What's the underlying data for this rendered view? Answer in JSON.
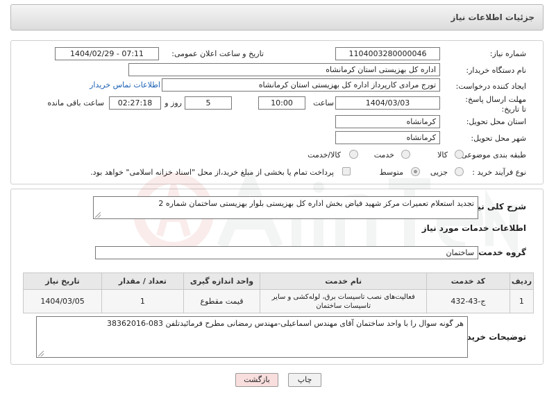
{
  "header": {
    "title": "جزئیات اطلاعات نیاز"
  },
  "form": {
    "need_number_label": "شماره نیاز:",
    "need_number": "1104003280000046",
    "announce_label": "تاریخ و ساعت اعلان عمومی:",
    "announce_value": "1404/02/29 - 07:11",
    "buyer_org_label": "نام دستگاه خریدار:",
    "buyer_org": "اداره کل بهزیستی استان کرمانشاه",
    "requester_label": "ایجاد کننده درخواست:",
    "requester": "تورج مرادی کارپرداز  اداره کل بهزیستی استان کرمانشاه",
    "contact_link": "اطلاعات تماس خریدار",
    "deadline_label": "مهلت ارسال پاسخ: تا تاریخ:",
    "deadline_date": "1404/03/03",
    "time_label": "ساعت",
    "deadline_time": "10:00",
    "days_value": "5",
    "days_label": "روز و",
    "remaining_value": "02:27:18",
    "remaining_label": "ساعت باقی مانده",
    "province_label": "استان محل تحویل:",
    "province": "کرمانشاه",
    "city_label": "شهر محل تحویل:",
    "city": "کرمانشاه",
    "category_label": "طبقه بندی موضوعی:",
    "category_options": [
      "کالا",
      "خدمت",
      "کالا/خدمت"
    ],
    "process_label": "نوع فرآیند خرید :",
    "process_options": [
      "جزیی",
      "متوسط"
    ],
    "payment_note": "پرداخت تمام یا بخشی از مبلغ خرید،از محل \"اسناد خزانه اسلامی\" خواهد بود."
  },
  "details": {
    "summary_label": "شرح کلی نیاز:",
    "summary": "تجدید استعلام تعمیرات مرکز شهید فیاض بخش اداره کل بهزیستی بلوار بهزیستی ساختمان شماره 2",
    "services_heading": "اطلاعات خدمات مورد نیاز",
    "service_group_label": "گروه خدمت:",
    "service_group": "ساختمان",
    "table": {
      "headers": [
        "ردیف",
        "کد خدمت",
        "نام خدمت",
        "واحد اندازه گیری",
        "تعداد / مقدار",
        "تاریخ نیاز"
      ],
      "rows": [
        [
          "1",
          "ج-43-432",
          "فعالیت‌های نصب تاسیسات برق، لوله‌کشی و سایر تاسیسات ساختمان",
          "قیمت مقطوع",
          "1",
          "1404/03/05"
        ]
      ]
    },
    "buyer_notes_label": "توضیحات خریدار:",
    "buyer_notes": "هر گونه سوال را  با واحد ساختمان  آقای مهندس اسماعیلی-مهندس رمضانی مطرح فرمائیدتلفن 083-38362016"
  },
  "actions": {
    "print": "چاپ",
    "back": "بازگشت"
  },
  "colors": {
    "link": "#1a5fb4",
    "back_button": "#f9dede",
    "watermark": "#c0392b"
  }
}
